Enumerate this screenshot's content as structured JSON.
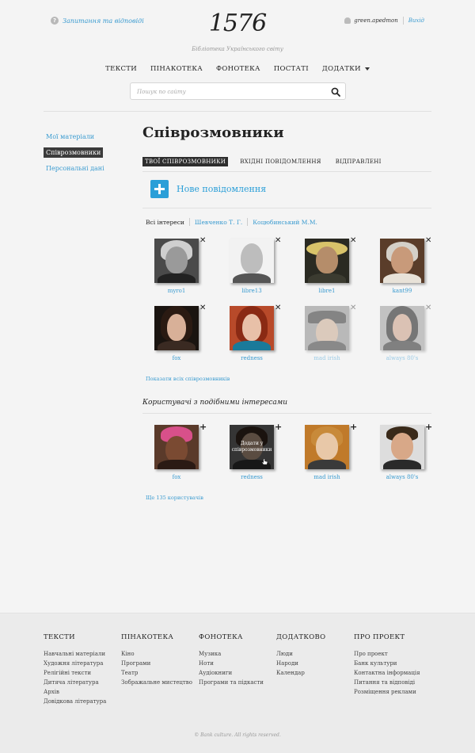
{
  "header": {
    "help_link": "Запитання та відповіді",
    "logo": "1576",
    "tagline": "Бібліотека Українського світу",
    "username": "green.apedmon",
    "logout": "Вихід"
  },
  "nav": {
    "items": [
      "ТЕКСТИ",
      "ПІНАКОТЕКА",
      "ФОНОТЕКА",
      "ПОСТАТІ",
      "ДОДАТКИ"
    ]
  },
  "search": {
    "placeholder": "Пошук по сайту"
  },
  "sidebar": {
    "items": [
      "Мої матеріали",
      "Співрозмовники",
      "Персональні дані"
    ]
  },
  "main": {
    "title": "Співрозмовники",
    "tabs": [
      "ТВОЇ СПІВРОЗМОВНИКИ",
      "ВХІДНІ ПОВІДОМЛЕННЯ",
      "ВІДПРАВЛЕНІ"
    ],
    "new_message": "Нове повідомлення",
    "filters": [
      "Всі інтереси",
      "Шевченко Т. Г.",
      "Коцюбинський М.М."
    ],
    "contacts": [
      {
        "name": "myro1",
        "faded": false
      },
      {
        "name": "libre13",
        "faded": false
      },
      {
        "name": "libre1",
        "faded": false
      },
      {
        "name": "kant99",
        "faded": false
      },
      {
        "name": "fox",
        "faded": false
      },
      {
        "name": "redness",
        "faded": false
      },
      {
        "name": "mad irish",
        "faded": true
      },
      {
        "name": "always 80's",
        "faded": true
      }
    ],
    "show_all": "Показати всіх співрозмовників",
    "similar_title": "Користувачі з подібними інтересами",
    "similar": [
      "fox",
      "redness",
      "mad irish",
      "always 80's"
    ],
    "add_overlay": "Додати у співрозмовники",
    "more_users": "Ще 135 користувачів"
  },
  "footer": {
    "columns": [
      {
        "title": "ТЕКСТИ",
        "links": [
          "Навчальні матеріали",
          "Художня література",
          "Релігійні тексти",
          "Дитяча література",
          "Архів",
          "Довідкова література"
        ]
      },
      {
        "title": "ПІНАКОТЕКА",
        "links": [
          "Кіно",
          "Програми",
          "Театр",
          "Зображальне мистецтво"
        ]
      },
      {
        "title": "ФОНОТЕКА",
        "links": [
          "Музика",
          "Ноти",
          "Аудіокниги",
          "Програми та підкасти"
        ]
      },
      {
        "title": "ДОДАТКОВО",
        "links": [
          "Люди",
          "Народи",
          "Календар"
        ]
      },
      {
        "title": "ПРО ПРОЕКТ",
        "links": [
          "Про проект",
          "Банк культури",
          "Контактна інформація",
          "Питання та відповіді",
          "Розміщення реклами"
        ]
      }
    ],
    "copyright": "© Bank culture. All rights reserved."
  },
  "colors": {
    "accent": "#3a9bd0",
    "button": "#2b9fd8",
    "active_tab": "#2e2e2e"
  }
}
